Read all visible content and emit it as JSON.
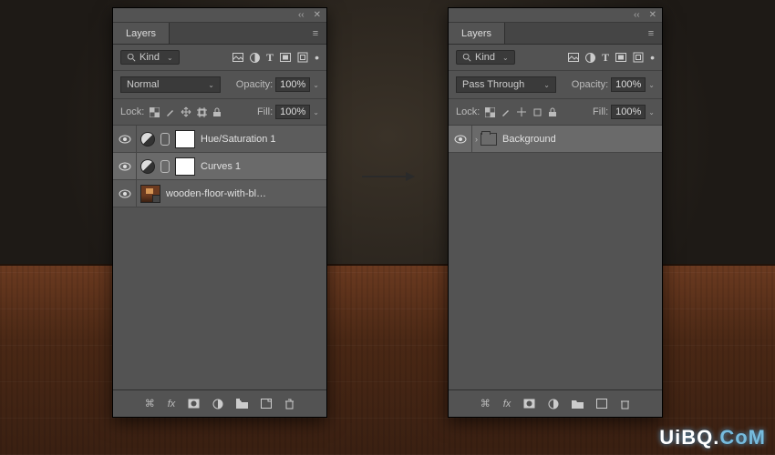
{
  "panels": {
    "left": {
      "tab": "Layers",
      "filter_label": "Kind",
      "blend_mode": "Normal",
      "opacity_label": "Opacity:",
      "opacity_value": "100%",
      "lock_label": "Lock:",
      "fill_label": "Fill:",
      "fill_value": "100%",
      "layers": [
        {
          "name": "Hue/Saturation 1",
          "type": "adjustment",
          "selected": false
        },
        {
          "name": "Curves 1",
          "type": "adjustment",
          "selected": true
        },
        {
          "name": "wooden-floor-with-blurred-...",
          "type": "smart_image",
          "selected": false
        }
      ]
    },
    "right": {
      "tab": "Layers",
      "filter_label": "Kind",
      "blend_mode": "Pass Through",
      "opacity_label": "Opacity:",
      "opacity_value": "100%",
      "lock_label": "Lock:",
      "fill_label": "Fill:",
      "fill_value": "100%",
      "layers": [
        {
          "name": "Background",
          "type": "group",
          "selected": true
        }
      ]
    }
  },
  "filter_icons": [
    "image-icon",
    "adjustment-icon",
    "type-icon",
    "shape-icon",
    "smart-icon",
    "dot-icon"
  ],
  "lock_icons": [
    "transparency-lock",
    "brush-lock",
    "move-lock",
    "crop-lock",
    "full-lock"
  ],
  "footer_icons": [
    "link-icon",
    "fx-icon",
    "mask-icon",
    "fill-adj-icon",
    "group-icon",
    "new-layer-icon",
    "trash-icon"
  ],
  "watermark_a": "UiBQ.",
  "watermark_b": "CoM"
}
